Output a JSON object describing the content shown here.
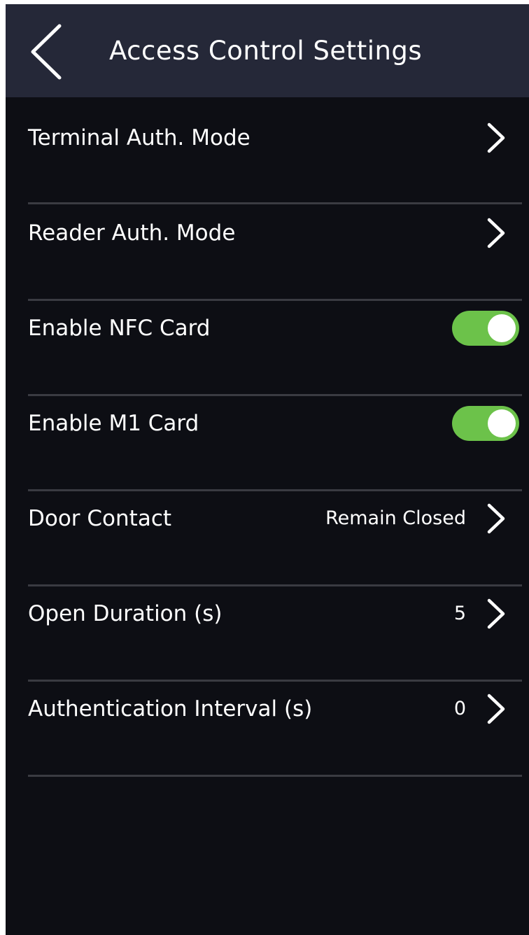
{
  "header": {
    "title": "Access Control Settings",
    "back_icon": "chevron-left-icon"
  },
  "rows": [
    {
      "label": "Terminal Auth. Mode",
      "value": "",
      "control": "chevron"
    },
    {
      "label": "Reader Auth. Mode",
      "value": "",
      "control": "chevron"
    },
    {
      "label": "Enable NFC Card",
      "control": "toggle",
      "enabled": true
    },
    {
      "label": "Enable M1 Card",
      "control": "toggle",
      "enabled": true
    },
    {
      "label": "Door Contact",
      "value": "Remain Closed",
      "control": "chevron"
    },
    {
      "label": "Open Duration (s)",
      "value": "5",
      "control": "chevron"
    },
    {
      "label": "Authentication Interval (s)",
      "value": "0",
      "control": "chevron"
    }
  ],
  "colors": {
    "header_bg": "#252838",
    "screen_bg": "#0d0e14",
    "toggle_on": "#6cc24a",
    "divider": "#3a3b42",
    "text": "#ffffff"
  }
}
